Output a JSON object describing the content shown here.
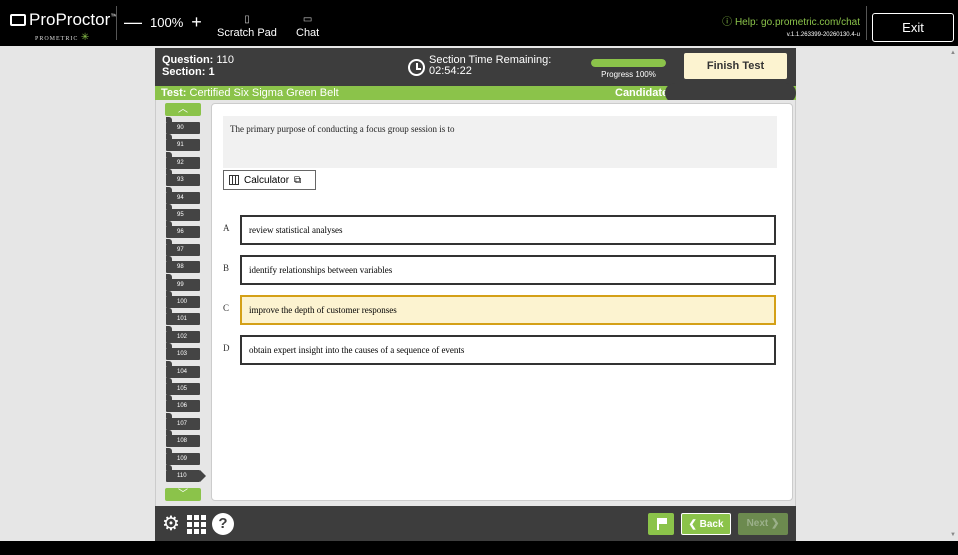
{
  "topbar": {
    "brand": "ProProctor",
    "brand_tm": "™",
    "sub": "PROMETRIC",
    "zoom_minus": "—",
    "zoom_level": "100%",
    "zoom_plus": "+",
    "scratch_pad": "Scratch Pad",
    "chat": "Chat",
    "help": "Help: go.prometric.com/chat",
    "version": "v.1.1.263399-20260130.4-u",
    "exit": "Exit"
  },
  "header": {
    "question_label": "Question:",
    "question_number": "110",
    "section_label": "Section:",
    "section_number": "1",
    "time_label": "Section Time Remaining:",
    "time_value": "02:54:22",
    "progress_label": "Progress 100%",
    "progress_value": 1.0,
    "finish": "Finish Test"
  },
  "testbar": {
    "test_label": "Test:",
    "test_name": "Certified Six Sigma Green Belt",
    "candidate_label": "Candidate"
  },
  "nav": {
    "items": [
      "90",
      "91",
      "92",
      "93",
      "94",
      "95",
      "96",
      "97",
      "98",
      "99",
      "100",
      "101",
      "102",
      "103",
      "104",
      "105",
      "106",
      "107",
      "108",
      "109",
      "110"
    ],
    "current": "110"
  },
  "question": {
    "stem": "The primary purpose of conducting a focus group session is to",
    "calculator": "Calculator",
    "options": [
      {
        "letter": "A",
        "text": "review statistical analyses",
        "selected": false
      },
      {
        "letter": "B",
        "text": "identify relationships between variables",
        "selected": false
      },
      {
        "letter": "C",
        "text": "improve the depth of customer responses",
        "selected": true
      },
      {
        "letter": "D",
        "text": "obtain expert insight into the causes of a sequence of events",
        "selected": false
      }
    ]
  },
  "footer": {
    "help": "?",
    "back": "❮ Back",
    "next": "Next ❯"
  },
  "colors": {
    "accent": "#8bc34a",
    "header_bg": "#3d3d3d",
    "selected_bg": "#fcf3d0",
    "selected_border": "#d4a017"
  }
}
